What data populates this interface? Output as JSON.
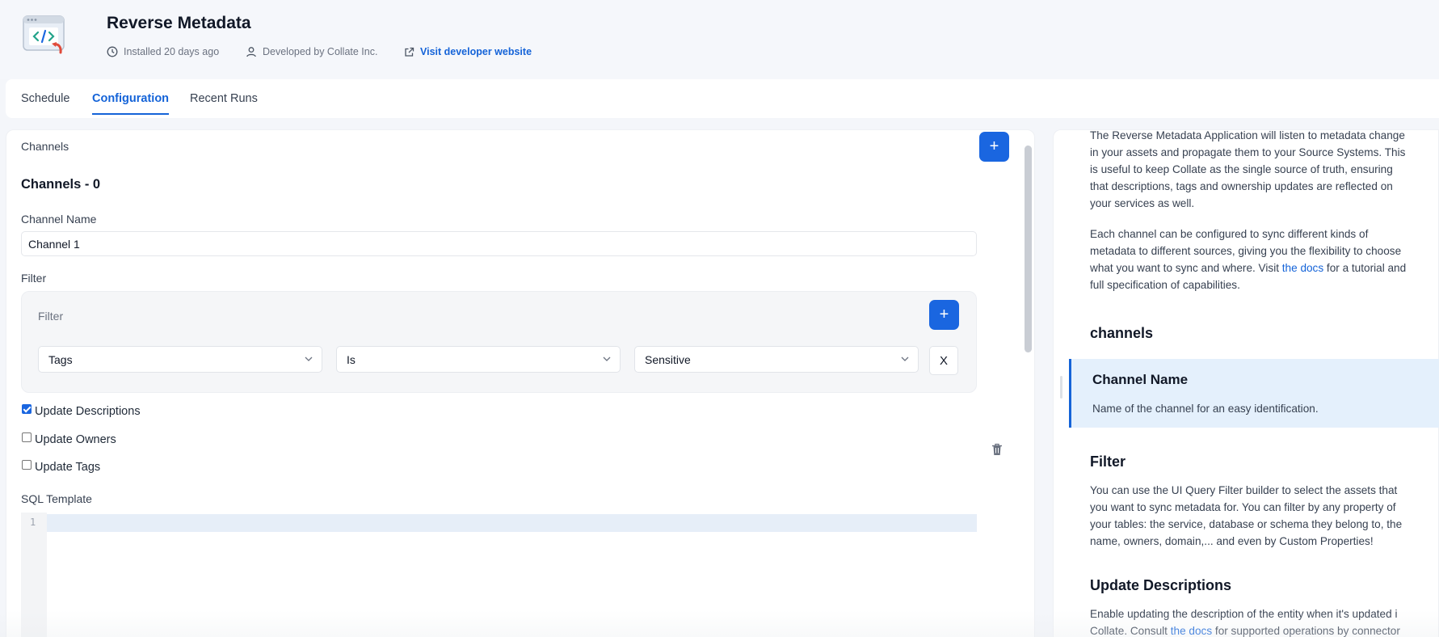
{
  "app": {
    "title": "Reverse Metadata",
    "installed": "Installed 20 days ago",
    "developer": "Developed by Collate Inc.",
    "website_link": "Visit developer website"
  },
  "tabs": [
    {
      "label": "Schedule",
      "active": false
    },
    {
      "label": "Configuration",
      "active": true
    },
    {
      "label": "Recent Runs",
      "active": false
    }
  ],
  "form": {
    "channels_label": "Channels",
    "channels_heading": "Channels - 0",
    "channel_name_label": "Channel Name",
    "channel_name_value": "Channel 1",
    "filter_label": "Filter",
    "filter_placeholder": "Filter",
    "filter_rule": {
      "field": "Tags",
      "operator": "Is",
      "value": "Sensitive"
    },
    "remove_rule_glyph": "X",
    "checkboxes": [
      {
        "label": "Update Descriptions",
        "checked": true
      },
      {
        "label": "Update Owners",
        "checked": false
      },
      {
        "label": "Update Tags",
        "checked": false
      }
    ],
    "sql_template_label": "SQL Template",
    "editor_line_number": "1"
  },
  "docs": {
    "intro": [
      "The Reverse Metadata Application will listen to metadata change",
      "in your assets and propagate them to your Source Systems. This",
      "is useful to keep Collate as the single source of truth, ensuring",
      "that descriptions, tags and ownership updates are reflected on",
      "your services as well."
    ],
    "channels_para": {
      "line1": "Each channel can be configured to sync different kinds of",
      "line2": "metadata to different sources, giving you the flexibility to choose",
      "line3_before": "what you want to sync and where. Visit ",
      "line3_link": "the docs",
      "line3_after": " for a tutorial and",
      "line4": "full specification of capabilities."
    },
    "channels_heading": "channels",
    "channel_name_heading": "Channel Name",
    "channel_name_desc": "Name of the channel for an easy identification.",
    "filter_heading": "Filter",
    "filter_desc": [
      "You can use the UI Query Filter builder to select the assets that",
      "you want to sync metadata for. You can filter by any property of",
      "your tables: the service, database or schema they belong to, the",
      "name, owners, domain,... and even by Custom Properties!"
    ],
    "update_desc_heading": "Update Descriptions",
    "update_desc_para": {
      "line1": "Enable updating the description of the entity when it's updated i",
      "line2_before": "Collate. Consult ",
      "line2_link": "the docs",
      "line2_after": " for supported operations by connector"
    }
  },
  "colors": {
    "accent": "#1463d8",
    "button": "#1a66e0",
    "highlight": "#e4f0fc",
    "delete_icon": "#6b7280"
  }
}
